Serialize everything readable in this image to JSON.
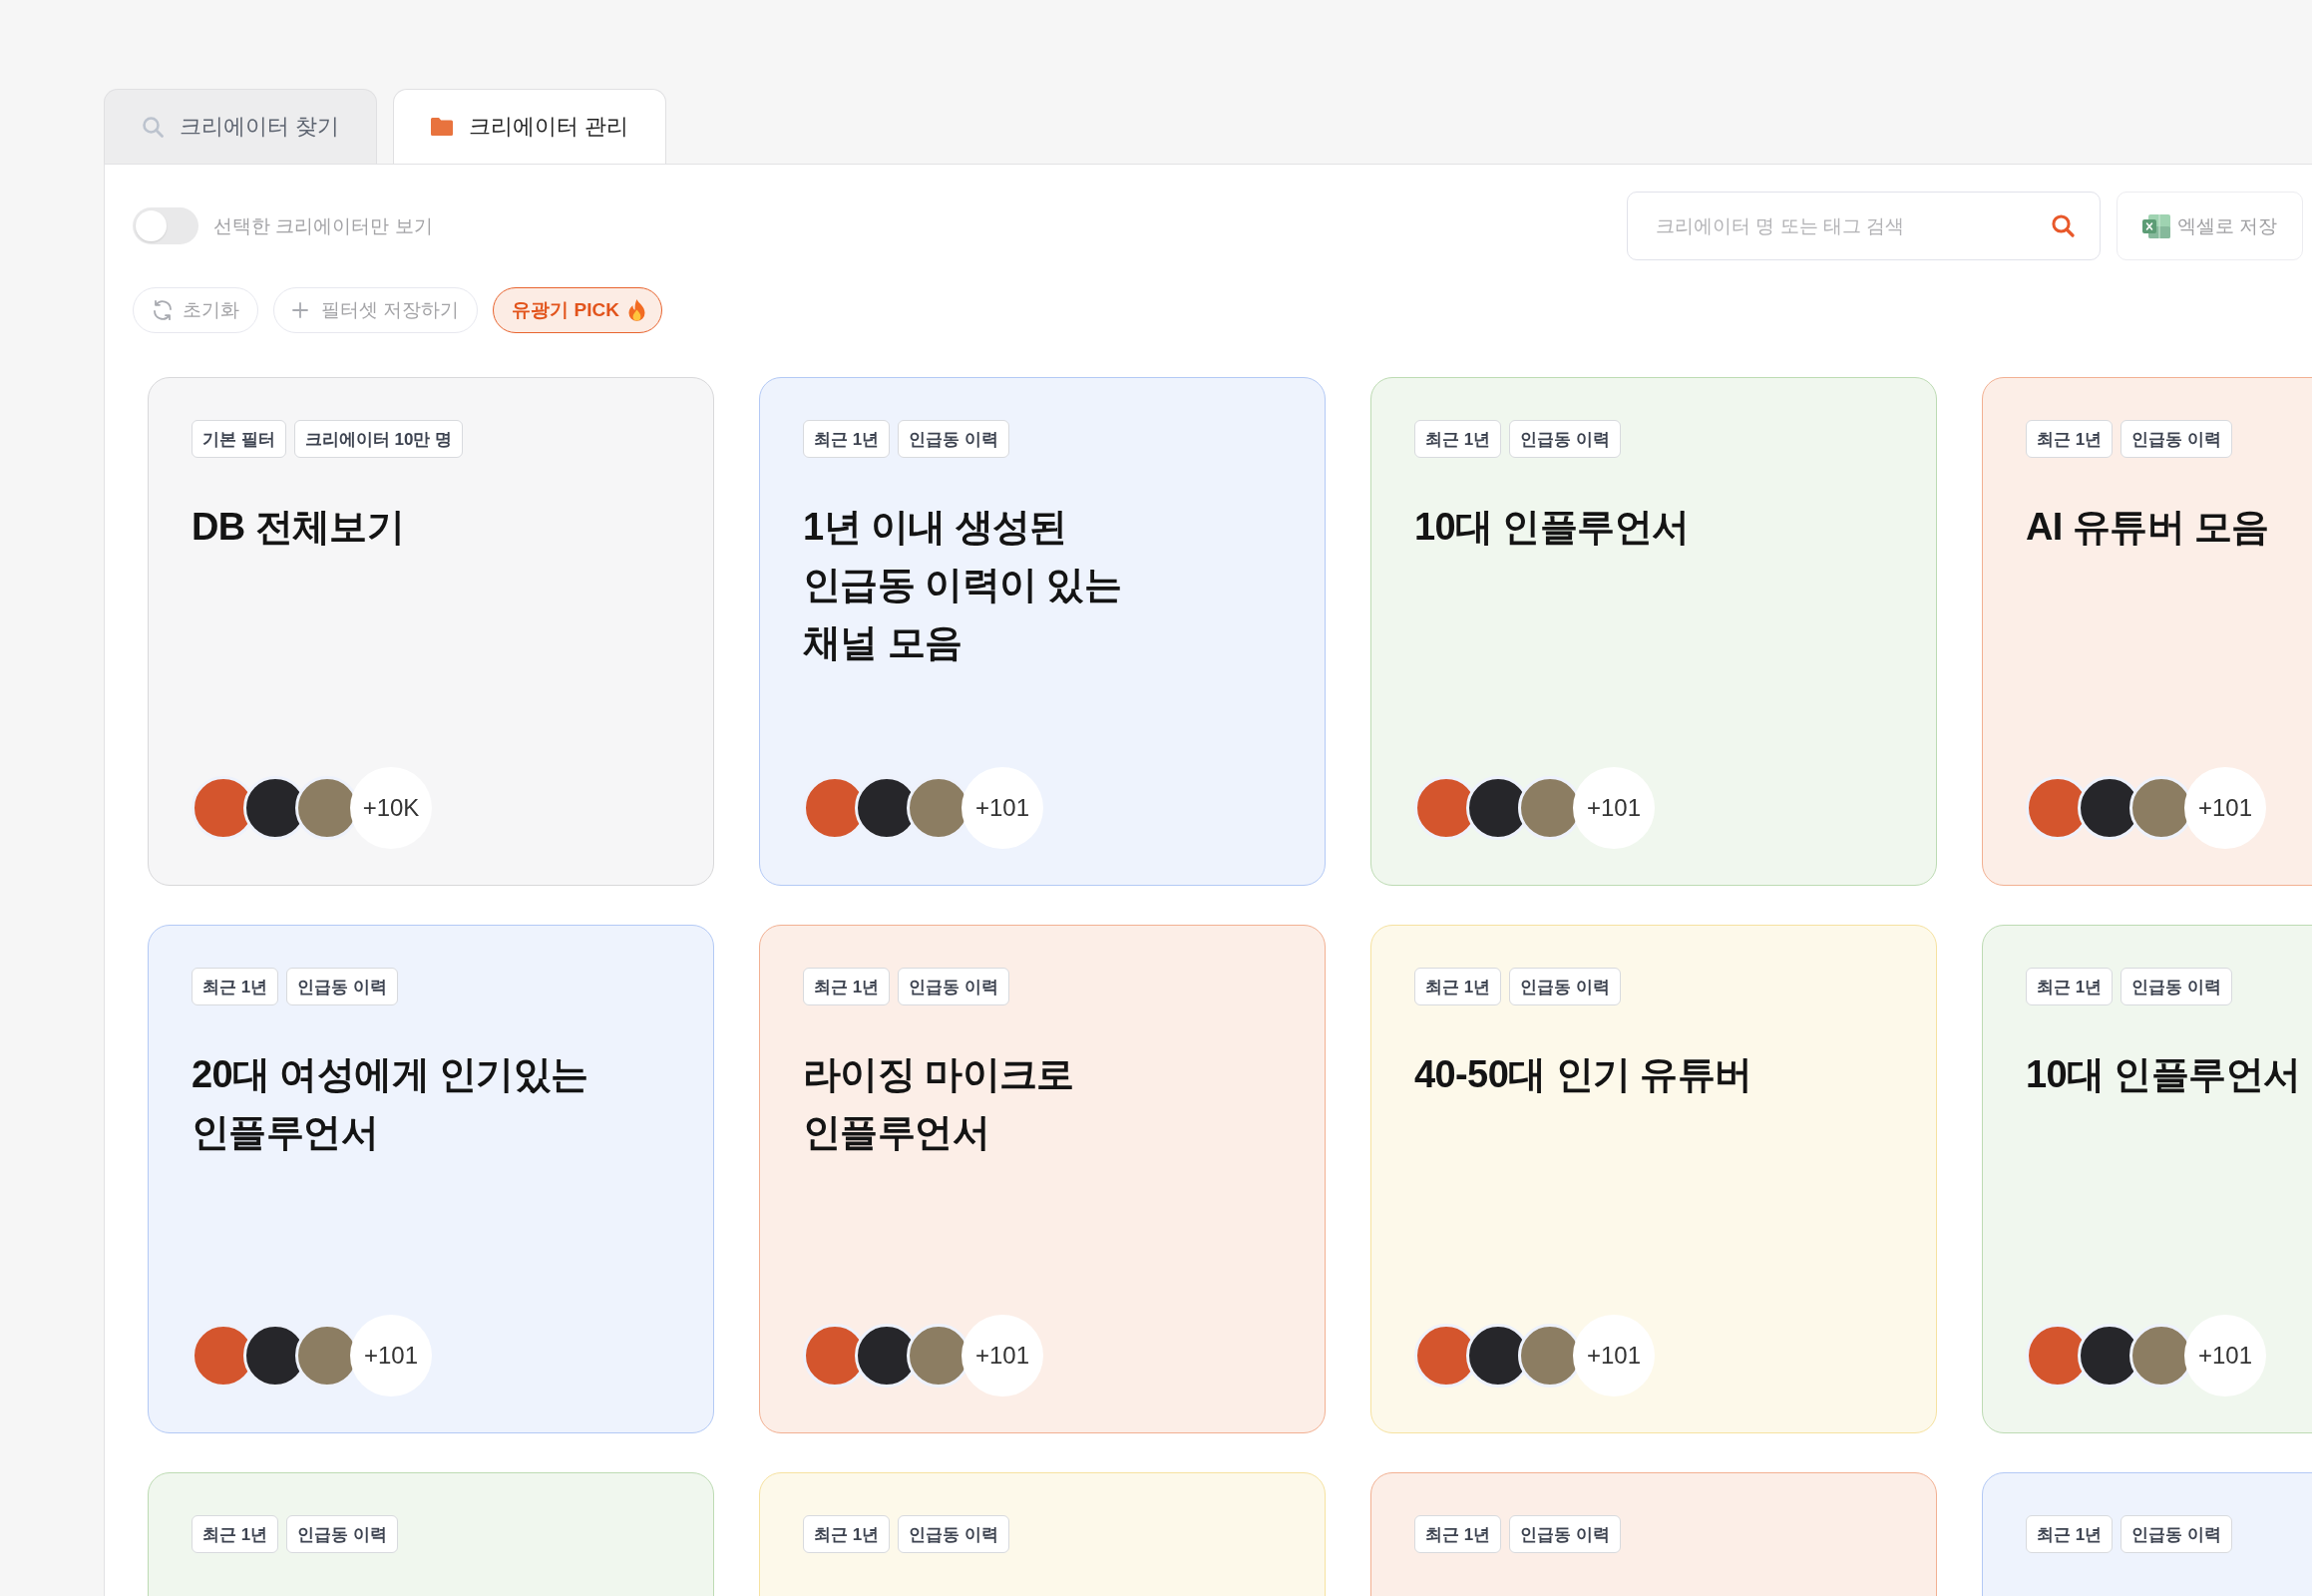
{
  "tabs": [
    {
      "kind": "find",
      "label": "크리에이터 찾기",
      "selected": false
    },
    {
      "kind": "manage",
      "label": "크리에이터 관리",
      "selected": true
    }
  ],
  "toolbar": {
    "toggle": {
      "label": "선택한 크리에이터만 보기",
      "on": false
    },
    "search": {
      "placeholder": "크리에이터 명 또는 태그 검색"
    },
    "export_button": "엑셀로 저장"
  },
  "filter_buttons": [
    {
      "kind": "reset",
      "label": "초기화"
    },
    {
      "kind": "add",
      "label": "필터셋 저장하기"
    },
    {
      "kind": "pick",
      "label": "유광기 PICK"
    }
  ],
  "cards": [
    {
      "color": "#d8d8da",
      "tags": [
        "기본 필터",
        "크리에이터 10만 명"
      ],
      "title": "DB 전체보기",
      "more_count": "+10K"
    },
    {
      "color": "#b3c9f5",
      "tags": [
        "최근 1년",
        "인급동 이력"
      ],
      "title": "1년 이내 생성된\n인급동 이력이 있는\n채널 모음",
      "more_count": "+101"
    },
    {
      "color": "#bddbb3",
      "tags": [
        "최근 1년",
        "인급동 이력"
      ],
      "title": "10대 인플루언서",
      "more_count": "+101"
    },
    {
      "color": "#f2b092",
      "tags": [
        "최근 1년",
        "인급동 이력"
      ],
      "title": "AI 유튜버 모음",
      "more_count": "+101"
    },
    {
      "color": "#b3c9f5",
      "tags": [
        "최근 1년",
        "인급동 이력"
      ],
      "title": "20대 여성에게 인기있는\n인플루언서",
      "more_count": "+101"
    },
    {
      "color": "#f2b092",
      "tags": [
        "최근 1년",
        "인급동 이력"
      ],
      "title": "라이징 마이크로\n인플루언서",
      "more_count": "+101"
    },
    {
      "color": "#f6e2a0",
      "tags": [
        "최근 1년",
        "인급동 이력"
      ],
      "title": "40-50대 인기 유튜버",
      "more_count": "+101"
    },
    {
      "color": "#bddbb3",
      "tags": [
        "최근 1년",
        "인급동 이력"
      ],
      "title": "10대 인플루언서",
      "more_count": "+101"
    },
    {
      "color": "#bddbb3",
      "tags": [
        "최근 1년",
        "인급동 이력"
      ]
    },
    {
      "color": "#f6e2a0",
      "tags": [
        "최근 1년",
        "인급동 이력"
      ]
    },
    {
      "color": "#f2b092",
      "tags": [
        "최근 1년",
        "인급동 이력"
      ]
    },
    {
      "color": "#b3c9f5",
      "tags": [
        "최근 1년",
        "인급동 이력"
      ]
    }
  ]
}
